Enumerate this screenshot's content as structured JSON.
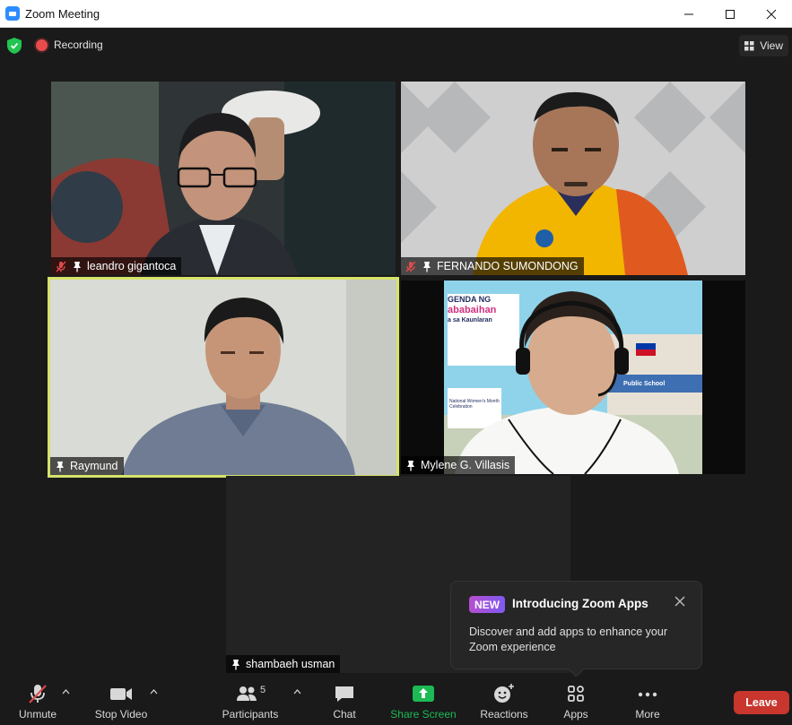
{
  "window": {
    "title": "Zoom Meeting",
    "minimize": "—",
    "maximize": "☐",
    "close": "✕"
  },
  "topbar": {
    "recording_label": "Recording",
    "view_label": "View"
  },
  "participants": [
    {
      "name": "leandro gigantoca",
      "muted": true
    },
    {
      "name": "FERNANDO SUMONDONG",
      "muted": true
    },
    {
      "name": "Raymund",
      "muted": false,
      "active_speaker": true
    },
    {
      "name": "Mylene G. Villasis",
      "muted": false
    },
    {
      "name": "shambaeh usman",
      "muted": false
    }
  ],
  "background_banner": {
    "line1": "GENDA NG",
    "line2": "ababaihan",
    "line3": "a sa Kaunlaran",
    "sign": "Public School",
    "poster": "National Women's Month Celebration"
  },
  "popup": {
    "badge": "NEW",
    "title": "Introducing Zoom Apps",
    "body": "Discover and add apps to enhance your Zoom experience"
  },
  "toolbar": {
    "unmute": "Unmute",
    "stop_video": "Stop Video",
    "participants": "Participants",
    "participants_count": "5",
    "chat": "Chat",
    "share_screen": "Share Screen",
    "reactions": "Reactions",
    "apps": "Apps",
    "more": "More",
    "leave": "Leave"
  },
  "colors": {
    "share_green": "#1db954",
    "leave_red": "#c8362d",
    "active_border": "#d6e36a",
    "shield_green": "#23c552"
  }
}
